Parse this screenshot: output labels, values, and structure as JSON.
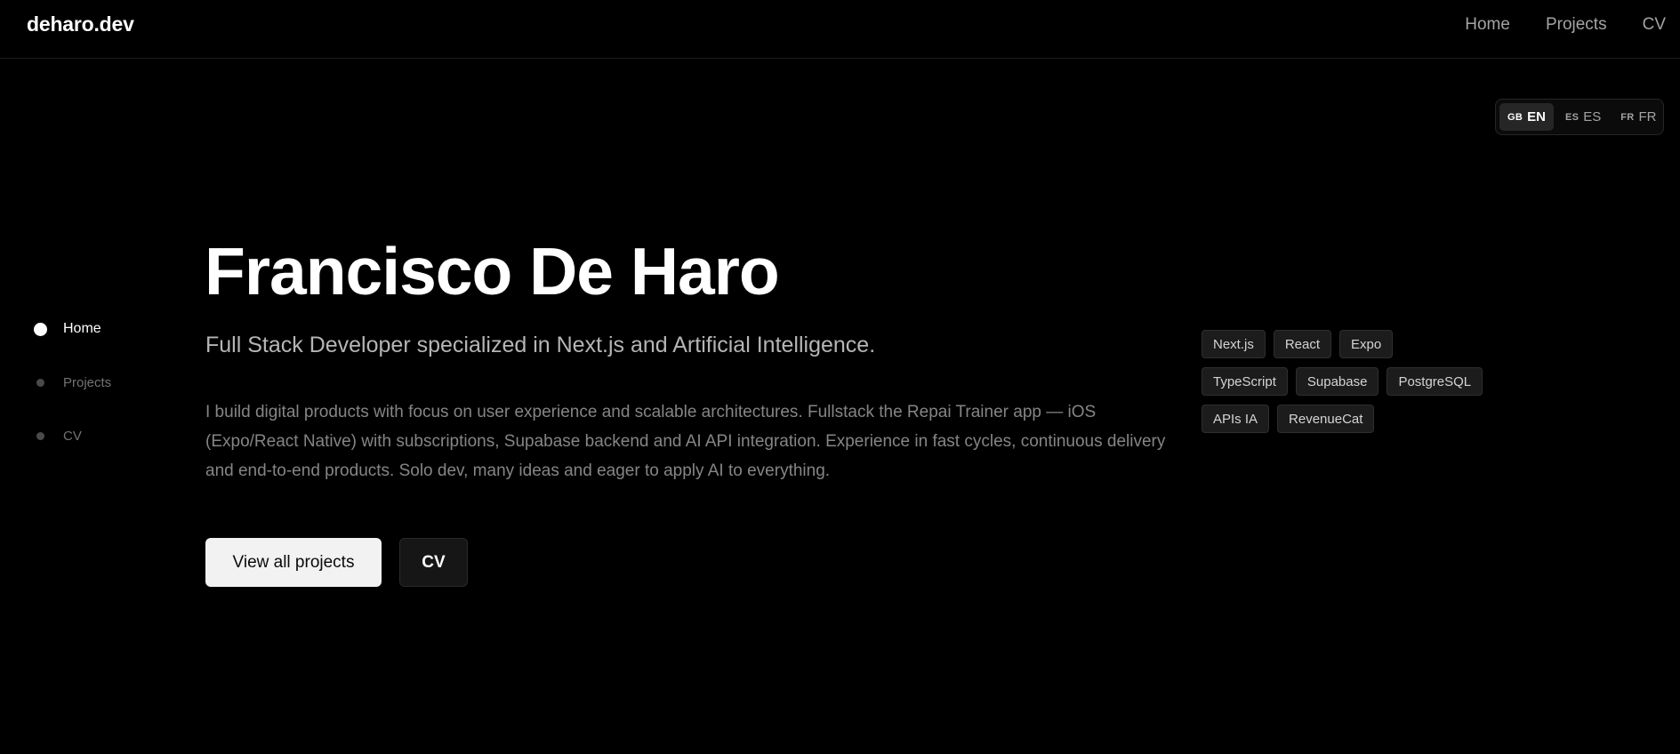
{
  "header": {
    "brand": "deharo.dev",
    "nav": [
      "Home",
      "Projects",
      "CV"
    ]
  },
  "language_switcher": {
    "options": [
      {
        "flag": "GB",
        "code": "EN",
        "active": true
      },
      {
        "flag": "ES",
        "code": "ES",
        "active": false
      },
      {
        "flag": "FR",
        "code": "FR",
        "active": false
      }
    ]
  },
  "side_nav": {
    "items": [
      {
        "label": "Home",
        "active": true
      },
      {
        "label": "Projects",
        "active": false
      },
      {
        "label": "CV",
        "active": false
      }
    ]
  },
  "hero": {
    "title": "Francisco De Haro",
    "subtitle": "Full Stack Developer specialized in Next.js and Artificial Intelligence.",
    "description": "I build digital products with focus on user experience and scalable architectures. Fullstack the Repai Trainer app — iOS (Expo/React Native) with subscriptions, Supabase backend and AI API integration. Experience in fast cycles, continuous delivery and end-to-end products. Solo dev, many ideas and eager to apply AI to everything.",
    "primary_button": "View all projects",
    "secondary_button": "CV"
  },
  "tech_tags": [
    [
      "Next.js",
      "React",
      "Expo"
    ],
    [
      "TypeScript",
      "Supabase",
      "PostgreSQL"
    ],
    [
      "APIs IA",
      "RevenueCat"
    ]
  ],
  "colors": {
    "background": "#000000",
    "text": "#ffffff",
    "muted": "#858585",
    "primary_button_bg": "#f2f2f2",
    "tag_bg": "#1c1c1c"
  }
}
